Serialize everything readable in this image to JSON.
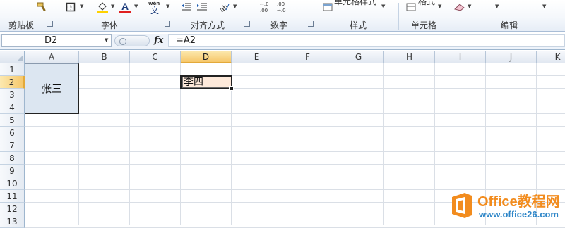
{
  "ribbon": {
    "groups": [
      {
        "label": "剪贴板"
      },
      {
        "label": "字体"
      },
      {
        "label": "对齐方式"
      },
      {
        "label": "数字"
      },
      {
        "label": "样式"
      },
      {
        "label": "单元格"
      },
      {
        "label": "编辑"
      }
    ],
    "cut_texts": {
      "cell_styles": "单元格样式",
      "format": "格式"
    },
    "font_color": "#e02020",
    "fill_color": "#ffd200"
  },
  "formula_bar": {
    "name_box": "D2",
    "fx_label": "fx",
    "formula": "=A2"
  },
  "sheet": {
    "columns": [
      "A",
      "B",
      "C",
      "D",
      "E",
      "F",
      "G",
      "H",
      "I",
      "J",
      "K"
    ],
    "rows": [
      "1",
      "2",
      "3",
      "4",
      "5",
      "6",
      "7",
      "8",
      "9",
      "10",
      "11",
      "12",
      "13"
    ],
    "active_column": "D",
    "active_row": "2",
    "cells": {
      "A2": "张三",
      "D2": "李四"
    },
    "merged_fill": "#dce6f1",
    "active_fill": "#fce4d6"
  },
  "watermark": {
    "title": "Office教程网",
    "url": "www.office26.com"
  }
}
